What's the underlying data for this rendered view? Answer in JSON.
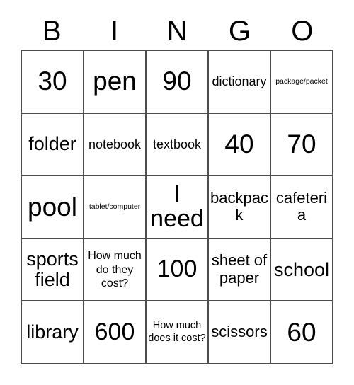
{
  "card": {
    "headers": [
      "B",
      "I",
      "N",
      "G",
      "O"
    ],
    "rows": [
      [
        {
          "text": "30",
          "size": "sz-xl"
        },
        {
          "text": "pen",
          "size": "sz-xl"
        },
        {
          "text": "90",
          "size": "sz-xl"
        },
        {
          "text": "dictionary",
          "size": "sz-sm"
        },
        {
          "text": "package/packet",
          "size": "sz-tiny"
        }
      ],
      [
        {
          "text": "folder",
          "size": "sz-ml"
        },
        {
          "text": "notebook",
          "size": "sz-sm"
        },
        {
          "text": "textbook",
          "size": "sz-sm"
        },
        {
          "text": "40",
          "size": "sz-xl"
        },
        {
          "text": "70",
          "size": "sz-xl"
        }
      ],
      [
        {
          "text": "pool",
          "size": "sz-xl"
        },
        {
          "text": "tablet/computer",
          "size": "sz-tiny"
        },
        {
          "text": "I need",
          "size": "sz-lg"
        },
        {
          "text": "backpack",
          "size": "sz-md"
        },
        {
          "text": "cafeteria",
          "size": "sz-md"
        }
      ],
      [
        {
          "text": "sports field",
          "size": "sz-ml"
        },
        {
          "text": "How much do they cost?",
          "size": "sz-xs"
        },
        {
          "text": "100",
          "size": "sz-lg"
        },
        {
          "text": "sheet of paper",
          "size": "sz-md"
        },
        {
          "text": "school",
          "size": "sz-ml"
        }
      ],
      [
        {
          "text": "library",
          "size": "sz-ml"
        },
        {
          "text": "600",
          "size": "sz-lg"
        },
        {
          "text": "How much does it cost?",
          "size": "sz-xxs"
        },
        {
          "text": "scissors",
          "size": "sz-md"
        },
        {
          "text": "60",
          "size": "sz-xl"
        }
      ]
    ]
  },
  "colors": {
    "border": "#4d4d4d",
    "text": "#000000",
    "background": "#ffffff"
  }
}
